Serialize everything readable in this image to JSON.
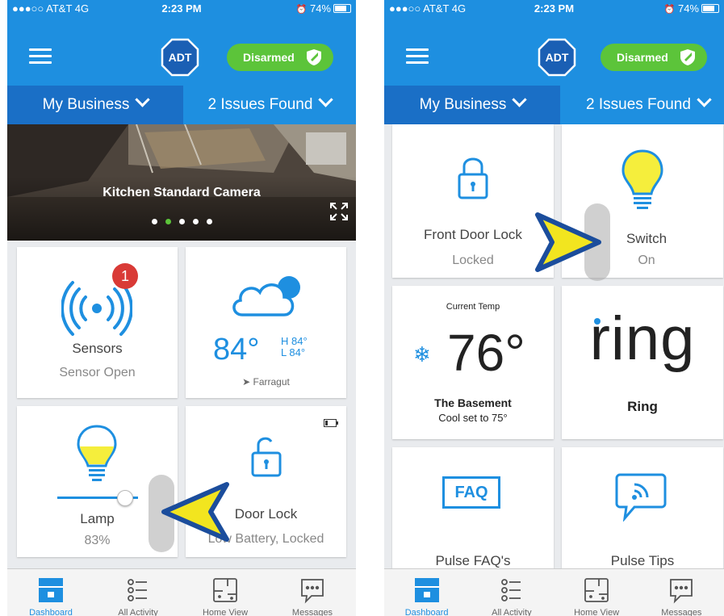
{
  "status": {
    "carrier": "●●●○○ AT&T  4G",
    "time": "2:23 PM",
    "battery": "74%"
  },
  "header": {
    "logo": "ADT",
    "alarm_status": "Disarmed",
    "location": "My Business",
    "issues": "2 Issues Found"
  },
  "camera": {
    "title": "Kitchen Standard Camera",
    "page_count": 5,
    "active_page": 2
  },
  "left_tiles": {
    "sensors": {
      "label": "Sensors",
      "status": "Sensor Open",
      "badge": "1"
    },
    "weather": {
      "temp": "84°",
      "high": "H 84°",
      "low": "L 84°",
      "city": "Farragut"
    },
    "lamp": {
      "label": "Lamp",
      "level": "83%",
      "level_value": 0.83
    },
    "door_lock": {
      "label": "Door Lock",
      "status": "Low Battery, Locked"
    }
  },
  "right_tiles": {
    "front_door": {
      "label": "Front Door Lock",
      "status": "Locked"
    },
    "switch": {
      "label": "Switch",
      "status": "On"
    },
    "thermostat": {
      "caption": "Current Temp",
      "temp": "76°",
      "name": "The Basement",
      "mode": "Cool set to 75°"
    },
    "ring": {
      "logo": "ring",
      "label": "Ring"
    },
    "faq": {
      "icon_text": "FAQ",
      "label": "Pulse FAQ's"
    },
    "tips": {
      "label": "Pulse Tips"
    }
  },
  "tabs": [
    {
      "label": "Dashboard",
      "active": true
    },
    {
      "label": "All Activity",
      "active": false
    },
    {
      "label": "Home View",
      "active": false
    },
    {
      "label": "Messages",
      "active": false
    }
  ],
  "colors": {
    "brand_blue": "#1e8fe0",
    "nav_blue": "#1a6fc6",
    "disarmed_green": "#5cc43a",
    "bulb_yellow": "#f5ee3c",
    "badge_red": "#d93a36",
    "pointer_blue": "#1b4d9c",
    "pointer_yellow": "#f2e51f"
  }
}
